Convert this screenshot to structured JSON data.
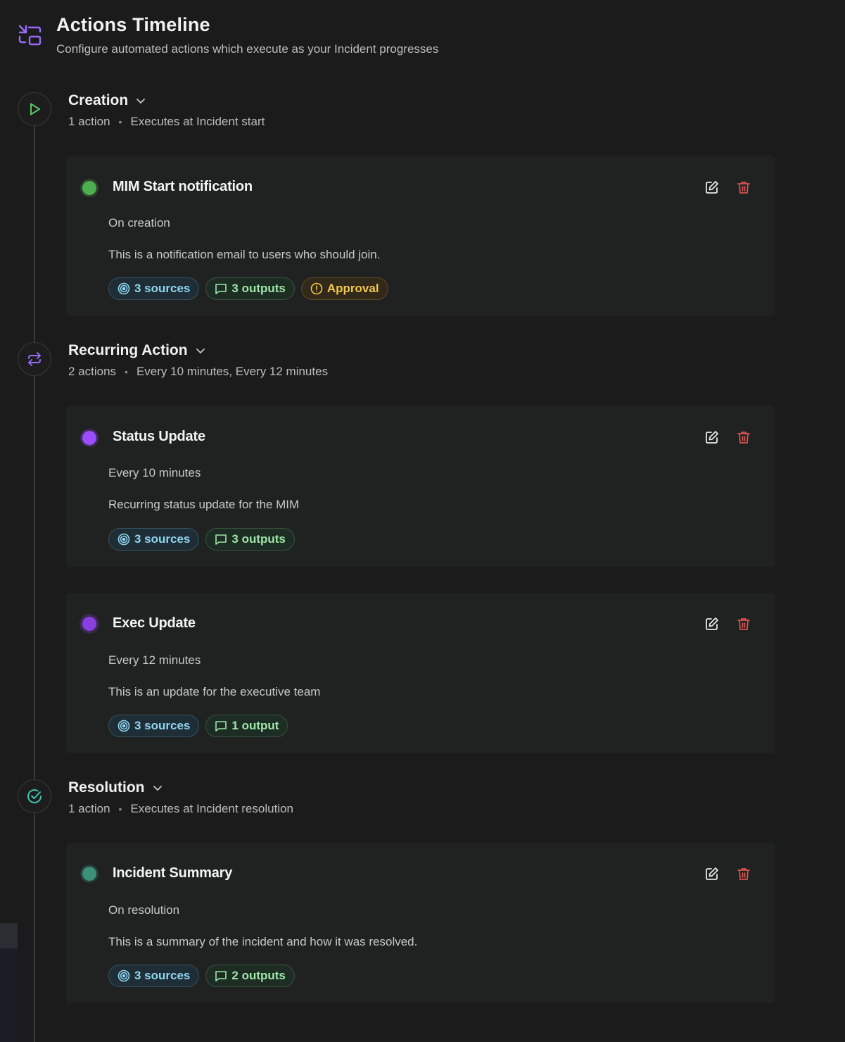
{
  "header": {
    "title": "Actions Timeline",
    "subtitle": "Configure automated actions which execute as your Incident progresses"
  },
  "stages": [
    {
      "title": "Creation",
      "count": "1 action",
      "schedule": "Executes at Incident start",
      "icon": "play-icon",
      "actions": [
        {
          "title": "MIM Start notification",
          "trigger": "On creation",
          "description": "This is a notification email to users who should join.",
          "dot_color": "#4caf50",
          "sources": "3 sources",
          "outputs": "3 outputs",
          "approval": "Approval"
        }
      ]
    },
    {
      "title": "Recurring Action",
      "count": "2 actions",
      "schedule": "Every 10 minutes, Every 12 minutes",
      "icon": "repeat-icon",
      "actions": [
        {
          "title": "Status Update",
          "trigger": "Every 10 minutes",
          "description": "Recurring status update for the MIM",
          "dot_color": "#9b4dff",
          "sources": "3 sources",
          "outputs": "3 outputs"
        },
        {
          "title": "Exec Update",
          "trigger": "Every 12 minutes",
          "description": "This is an update for the executive team",
          "dot_color": "#8a3fe0",
          "sources": "3 sources",
          "outputs": "1 output"
        }
      ]
    },
    {
      "title": "Resolution",
      "count": "1 action",
      "schedule": "Executes at Incident resolution",
      "icon": "check-circle-icon",
      "actions": [
        {
          "title": "Incident Summary",
          "trigger": "On resolution",
          "description": "This is a summary of the incident and how it was resolved.",
          "dot_color": "#3e8f78",
          "sources": "3 sources",
          "outputs": "2 outputs"
        }
      ]
    }
  ],
  "colors": {
    "accent_purple": "#9b6bff",
    "creation_green": "#5cc46a",
    "resolution_teal": "#3fc7b0",
    "delete_red": "#d9534f"
  }
}
